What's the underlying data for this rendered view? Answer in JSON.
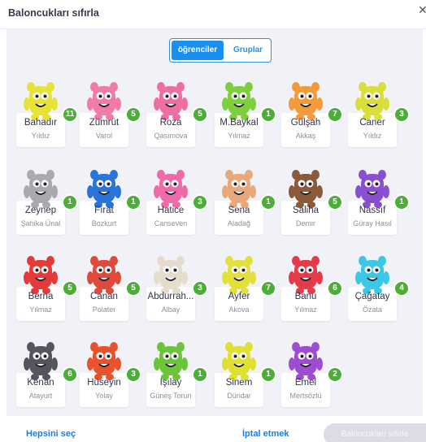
{
  "header": {
    "title": "Baloncukları sıfırla",
    "close_glyph": "✕"
  },
  "tabs": [
    {
      "label": "öğrenciler",
      "active": true
    },
    {
      "label": "Gruplar",
      "active": false
    }
  ],
  "students": [
    {
      "first": "Bahadır",
      "last": "Yıldız",
      "points": "11",
      "color": "#e6e336",
      "icon": "yellow-monster-icon"
    },
    {
      "first": "Zümrüt",
      "last": "Varol",
      "points": "5",
      "color": "#f07aa8",
      "icon": "pink-monster-icon"
    },
    {
      "first": "Roza",
      "last": "Qasımova",
      "points": "5",
      "color": "#ee6ea4",
      "icon": "pink-monster-icon"
    },
    {
      "first": "M.Baykal",
      "last": "Yılmaz",
      "points": "1",
      "color": "#7dcf3c",
      "icon": "green-monster-icon"
    },
    {
      "first": "Gülşah",
      "last": "Akkaş",
      "points": "7",
      "color": "#f39a3a",
      "icon": "orange-monster-icon"
    },
    {
      "first": "Caner",
      "last": "Yıldız",
      "points": "3",
      "color": "#d8df3a",
      "icon": "yellow-monster-icon"
    },
    {
      "first": "Zeynep",
      "last": "Şahika Ünal",
      "points": "1",
      "color": "#a9a9ae",
      "icon": "gray-monster-icon"
    },
    {
      "first": "Fırat",
      "last": "Bozkurt",
      "points": "1",
      "color": "#2a73d8",
      "icon": "blue-monster-icon"
    },
    {
      "first": "Hatice",
      "last": "Canseven",
      "points": "3",
      "color": "#ef6aa8",
      "icon": "pink-monster-icon"
    },
    {
      "first": "Sena",
      "last": "Aladağ",
      "points": "1",
      "color": "#e9a87a",
      "icon": "tan-monster-icon"
    },
    {
      "first": "Saliha",
      "last": "Demir",
      "points": "5",
      "color": "#8a5a3a",
      "icon": "brown-monster-icon"
    },
    {
      "first": "Nassıf",
      "last": "Güray Hasıl",
      "points": "1",
      "color": "#8a4ed0",
      "icon": "purple-monster-icon"
    },
    {
      "first": "Berna",
      "last": "Yılmaz",
      "points": "5",
      "color": "#e53a3a",
      "icon": "red-monster-icon"
    },
    {
      "first": "Canan",
      "last": "Polater",
      "points": "5",
      "color": "#e04a3a",
      "icon": "red-monster-icon"
    },
    {
      "first": "Abdurrah...",
      "last": "Albay",
      "points": "3",
      "color": "#e6dccc",
      "icon": "cream-monster-icon"
    },
    {
      "first": "Ayfer",
      "last": "Akova",
      "points": "7",
      "color": "#e3e03a",
      "icon": "yellow-monster-icon"
    },
    {
      "first": "Banu",
      "last": "Yılmaz",
      "points": "6",
      "color": "#e53a48",
      "icon": "red-monster-icon"
    },
    {
      "first": "Çağatay",
      "last": "Özata",
      "points": "4",
      "color": "#3ac8e6",
      "icon": "cyan-monster-icon"
    },
    {
      "first": "Kenan",
      "last": "Atayurt",
      "points": "6",
      "color": "#55555e",
      "icon": "black-monster-icon"
    },
    {
      "first": "Hüseyin",
      "last": "Yolay",
      "points": "3",
      "color": "#e8532e",
      "icon": "orange-monster-icon"
    },
    {
      "first": "Işılay",
      "last": "Güneş Torun",
      "points": "1",
      "color": "#6bc43a",
      "icon": "green-monster-icon"
    },
    {
      "first": "Sinem",
      "last": "Dündar",
      "points": "1",
      "color": "#e0e030",
      "icon": "yellow-monster-icon"
    },
    {
      "first": "Emel",
      "last": "Mertsözlü",
      "points": "2",
      "color": "#9d4ed0",
      "icon": "purple-monster-icon"
    }
  ],
  "footer": {
    "select_all": "Hepsini seç",
    "cancel": "İptal etmek",
    "reset": "Baloncukları sıfırla"
  }
}
